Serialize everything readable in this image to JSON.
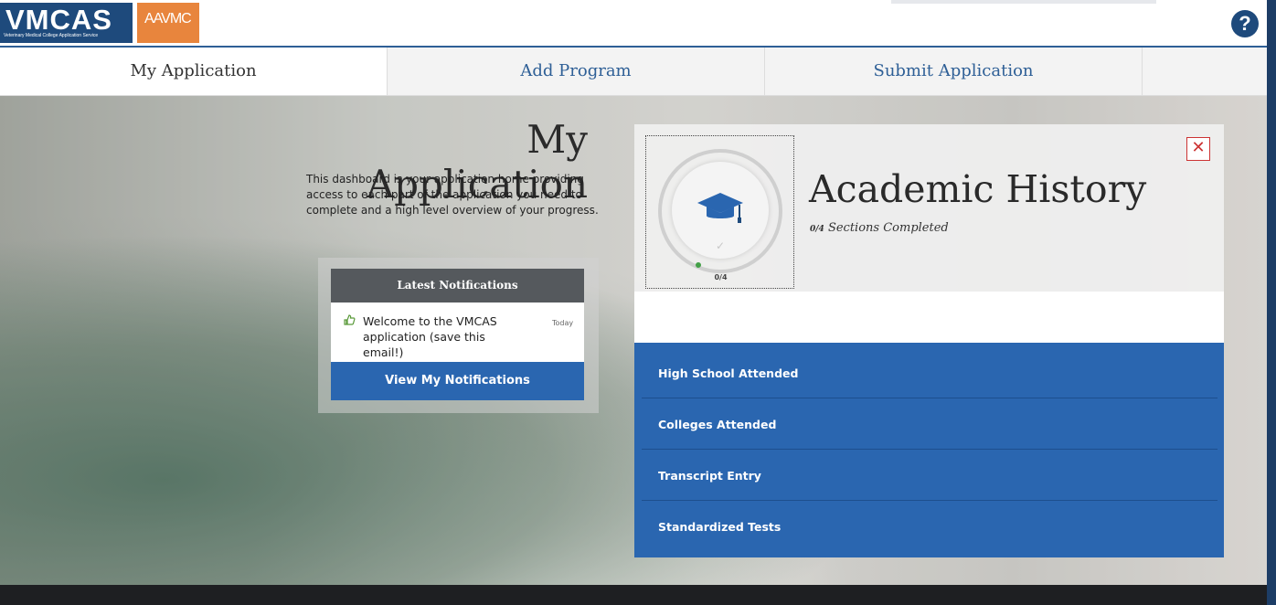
{
  "header": {
    "logo_vmcas_text": "VMCAS",
    "logo_vmcas_subtext": "Veterinary Medical College Application Service",
    "logo_aavmc_text": "AAVMC",
    "help_icon_glyph": "?"
  },
  "tabs": [
    {
      "label": "My Application",
      "active": true
    },
    {
      "label": "Add Program",
      "active": false
    },
    {
      "label": "Submit Application",
      "active": false
    }
  ],
  "intro": {
    "title": "My Application",
    "description": "This dashboard is your application home providing access to each part of the application you need to complete and a high level overview of your progress."
  },
  "notifications": {
    "heading": "Latest Notifications",
    "items": [
      {
        "message": "Welcome to the VMCAS application (save this email!)",
        "date": "Today"
      }
    ],
    "view_button": "View My Notifications"
  },
  "academic_history": {
    "title": "Academic History",
    "progress_completed": 0,
    "progress_total": 4,
    "progress_label": "0/4",
    "subtitle_count": "0/4",
    "subtitle_text": "Sections Completed",
    "close_glyph": "✕",
    "sections": [
      {
        "label": "High School Attended"
      },
      {
        "label": "Colleges Attended"
      },
      {
        "label": "Transcript Entry"
      },
      {
        "label": "Standardized Tests"
      }
    ]
  },
  "colors": {
    "brand_dark": "#1e4a7c",
    "brand_orange": "#e8853d",
    "action_blue": "#2a66b0",
    "close_red": "#cc3333",
    "progress_green": "#43a047"
  }
}
